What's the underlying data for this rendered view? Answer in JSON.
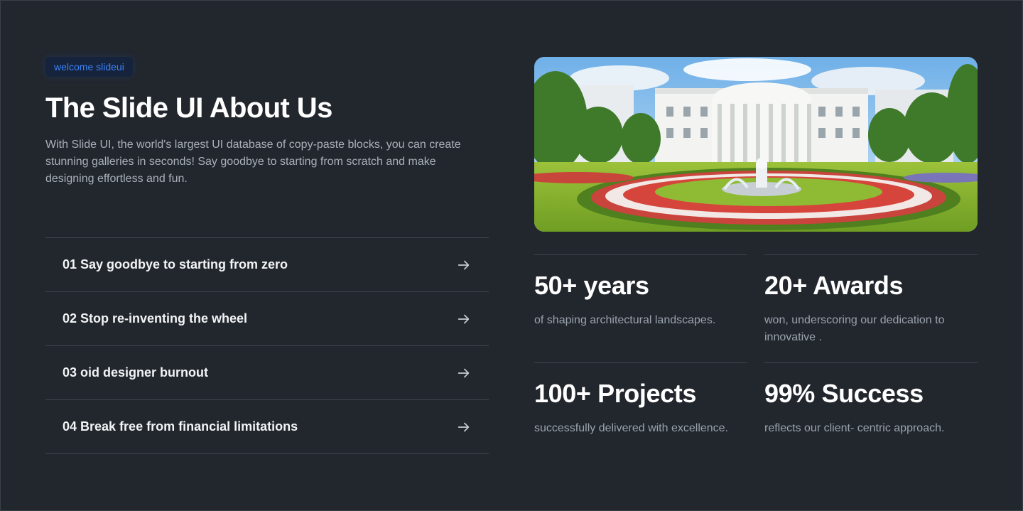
{
  "badge": "welcome slideui",
  "title": "The Slide UI About Us",
  "description": "With Slide UI, the world's largest UI database of copy-paste blocks, you can create stunning galleries in seconds! Say goodbye to starting from scratch and make designing effortless and fun.",
  "features": [
    {
      "label": "01 Say goodbye to starting from zero",
      "icon": "arrow-right-icon"
    },
    {
      "label": "02 Stop re-inventing the wheel",
      "icon": "arrow-right-icon"
    },
    {
      "label": "03 oid designer burnout",
      "icon": "arrow-right-icon"
    },
    {
      "label": "04 Break free from financial limitations",
      "icon": "arrow-right-icon"
    }
  ],
  "hero_image": {
    "subject": "white-house-garden-illustration"
  },
  "stats": [
    {
      "value": "50+ years",
      "caption": "of shaping architectural landscapes."
    },
    {
      "value": "20+ Awards",
      "caption": "won, underscoring our dedication to innovative ."
    },
    {
      "value": "100+ Projects",
      "caption": "successfully delivered with excellence."
    },
    {
      "value": "99% Success",
      "caption": "reflects our client- centric approach."
    }
  ],
  "colors": {
    "background": "#22272d",
    "accent": "#3b82f6",
    "divider": "#3f464e",
    "muted_text": "#9aa2ac"
  }
}
